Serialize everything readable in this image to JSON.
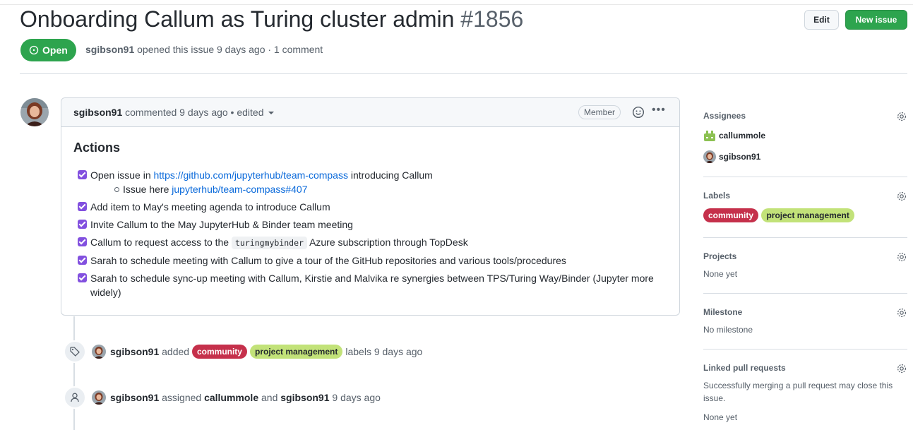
{
  "issue": {
    "title": "Onboarding Callum as Turing cluster admin",
    "number": "#1856",
    "state": "Open",
    "author": "sgibson91",
    "meta_rest": "opened this issue 9 days ago · 1 comment",
    "edit_label": "Edit",
    "new_issue_label": "New issue"
  },
  "comment": {
    "author": "sgibson91",
    "meta": "commented 9 days ago • edited",
    "badge": "Member",
    "heading": "Actions",
    "tasks": {
      "t1": {
        "pre": "Open issue in",
        "link": "https://github.com/jupyterhub/team-compass",
        "post": "introducing Callum",
        "sub_pre": "Issue here",
        "sub_link": "jupyterhub/team-compass#407"
      },
      "t2": "Add item to May's meeting agenda to introduce Callum",
      "t3": "Invite Callum to the May JupyterHub & Binder team meeting",
      "t4_pre": "Callum to request access to the",
      "t4_code": "turingmybinder",
      "t4_post": "Azure subscription through TopDesk",
      "t5": "Sarah to schedule meeting with Callum to give a tour of the GitHub repositories and various tools/procedures",
      "t6": "Sarah to schedule sync-up meeting with Callum, Kirstie and Malvika re synergies between TPS/Turing Way/Binder (Jupyter more widely)"
    }
  },
  "timeline": {
    "labels_event": {
      "actor": "sgibson91",
      "verb": "added",
      "label_1": "community",
      "label_2": "project management",
      "suffix": "labels 9 days ago"
    },
    "assign_event": {
      "actor": "sgibson91",
      "verb": "assigned",
      "user_1": "callummole",
      "conj": "and",
      "user_2": "sgibson91",
      "suffix": "9 days ago"
    }
  },
  "sidebar": {
    "assignees": {
      "heading": "Assignees",
      "users": [
        "callummole",
        "sgibson91"
      ]
    },
    "labels": {
      "heading": "Labels",
      "items": [
        "community",
        "project management"
      ]
    },
    "projects": {
      "heading": "Projects",
      "value": "None yet"
    },
    "milestone": {
      "heading": "Milestone",
      "value": "No milestone"
    },
    "linked_prs": {
      "heading": "Linked pull requests",
      "description": "Successfully merging a pull request may close this issue.",
      "value": "None yet"
    }
  },
  "icons": {
    "state": "issue-opened-icon",
    "reaction": "smiley-icon",
    "more": "kebab-horizontal-icon",
    "tag": "tag-icon",
    "person": "person-icon",
    "settings": "gear-icon"
  },
  "colors": {
    "open": "#2da44e",
    "link": "#0969da",
    "task_checked": "#8250df",
    "label_community": "#c5304b",
    "label_pm": "#c2e279"
  }
}
